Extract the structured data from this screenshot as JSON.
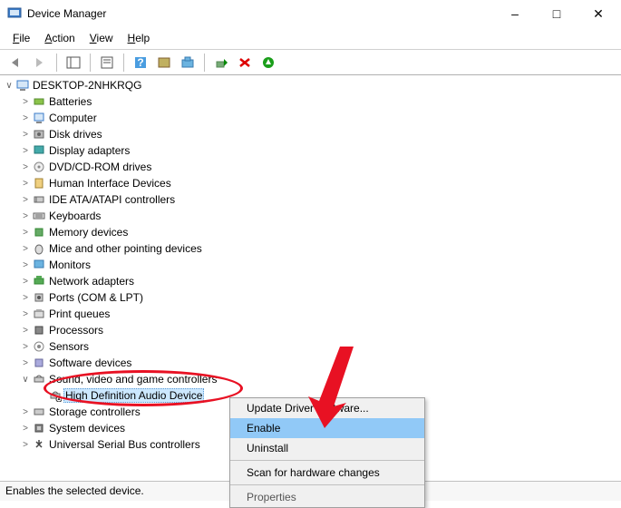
{
  "title": "Device Manager",
  "menus": {
    "file": "File",
    "action": "Action",
    "view": "View",
    "help": "Help"
  },
  "root": "DESKTOP-2NHKRQG",
  "categories": [
    "Batteries",
    "Computer",
    "Disk drives",
    "Display adapters",
    "DVD/CD-ROM drives",
    "Human Interface Devices",
    "IDE ATA/ATAPI controllers",
    "Keyboards",
    "Memory devices",
    "Mice and other pointing devices",
    "Monitors",
    "Network adapters",
    "Ports (COM & LPT)",
    "Print queues",
    "Processors",
    "Sensors",
    "Software devices",
    "Sound, video and game controllers",
    "Storage controllers",
    "System devices",
    "Universal Serial Bus controllers"
  ],
  "selected_device": "High Definition Audio Device",
  "context_menu": {
    "update": "Update Driver Software...",
    "enable": "Enable",
    "uninstall": "Uninstall",
    "scan": "Scan for hardware changes",
    "properties": "Properties"
  },
  "status": "Enables the selected device."
}
